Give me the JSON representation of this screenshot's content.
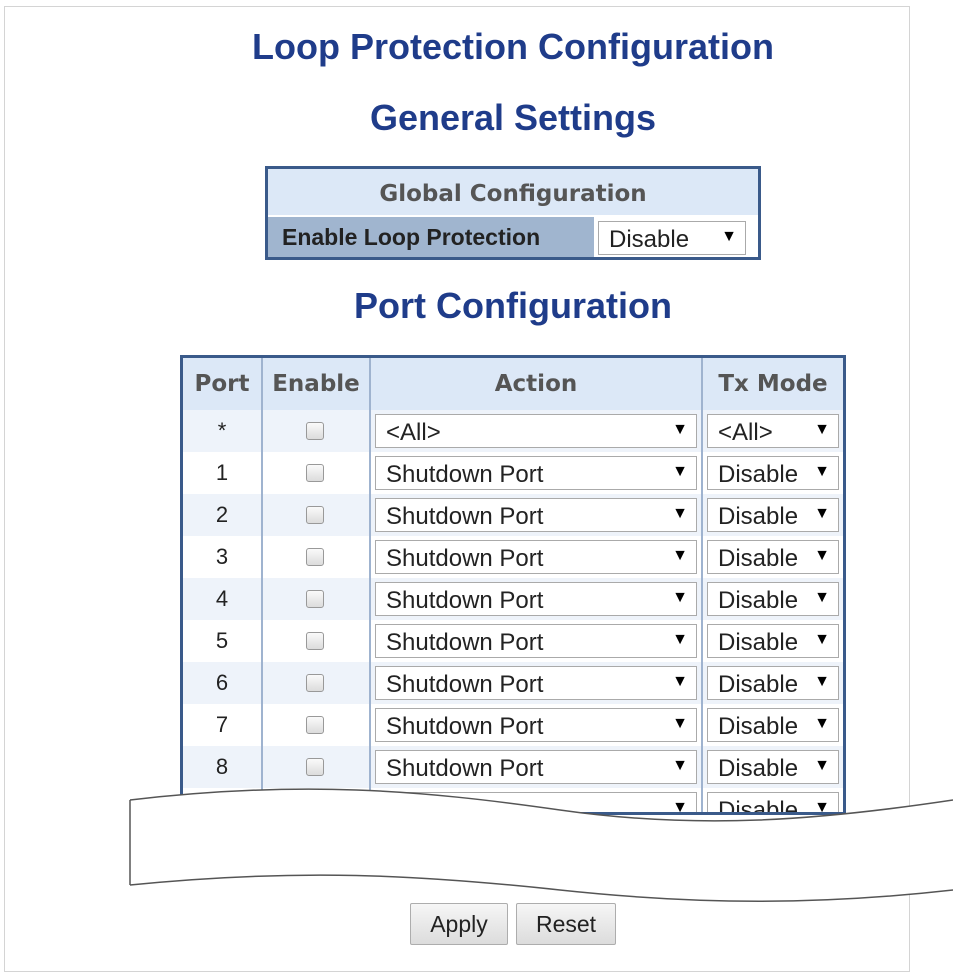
{
  "page": {
    "title": "Loop Protection Configuration",
    "general_title": "General Settings",
    "port_title": "Port Configuration"
  },
  "global": {
    "header": "Global Configuration",
    "enable_label": "Enable Loop Protection",
    "enable_value": "Disable"
  },
  "table": {
    "headers": {
      "port": "Port",
      "enable": "Enable",
      "action": "Action",
      "tx_mode": "Tx Mode"
    },
    "rows": [
      {
        "port": "*",
        "action": "<All>",
        "tx_mode": "<All>"
      },
      {
        "port": "1",
        "action": "Shutdown Port",
        "tx_mode": "Disable"
      },
      {
        "port": "2",
        "action": "Shutdown Port",
        "tx_mode": "Disable"
      },
      {
        "port": "3",
        "action": "Shutdown Port",
        "tx_mode": "Disable"
      },
      {
        "port": "4",
        "action": "Shutdown Port",
        "tx_mode": "Disable"
      },
      {
        "port": "5",
        "action": "Shutdown Port",
        "tx_mode": "Disable"
      },
      {
        "port": "6",
        "action": "Shutdown Port",
        "tx_mode": "Disable"
      },
      {
        "port": "7",
        "action": "Shutdown Port",
        "tx_mode": "Disable"
      },
      {
        "port": "8",
        "action": "Shutdown Port",
        "tx_mode": "Disable"
      },
      {
        "port": "",
        "action": "",
        "tx_mode": "Disable"
      }
    ]
  },
  "buttons": {
    "apply": "Apply",
    "reset": "Reset"
  },
  "icons": {
    "dropdown": "▼"
  }
}
